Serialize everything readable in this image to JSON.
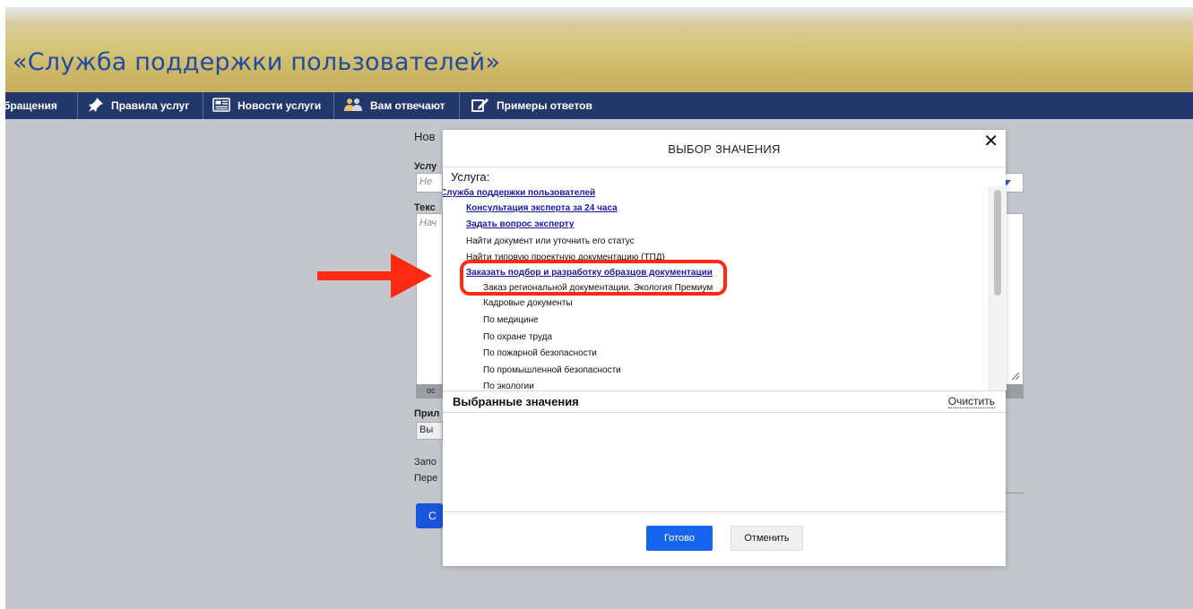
{
  "app": {
    "title": "«Служба поддержки пользователей»"
  },
  "nav": {
    "items": [
      {
        "label": "бращения",
        "icon": "none"
      },
      {
        "label": "Правила услуг",
        "icon": "pin-icon"
      },
      {
        "label": "Новости услуги",
        "icon": "news-icon"
      },
      {
        "label": "Вам отвечают",
        "icon": "people-icon"
      },
      {
        "label": "Примеры ответов",
        "icon": "edit-icon"
      }
    ]
  },
  "background_form": {
    "heading_fragment": "Нов",
    "service_label_fragment": "Услу",
    "service_placeholder_fragment": "Не",
    "text_label_fragment": "Текс",
    "text_placeholder_fragment": "Нач",
    "status_fragment": "ос",
    "attach_label_fragment": "Прил",
    "attach_button_fragment": "Вы",
    "note1_fragment": "Запо",
    "note2_fragment": "Пере",
    "submit_fragment": "С"
  },
  "modal": {
    "title": "ВЫБОР ЗНАЧЕНИЯ",
    "close_symbol": "✕",
    "section_label": "Услуга:",
    "tree": [
      {
        "label": "Служба поддержки пользователей",
        "level": 0,
        "link": true
      },
      {
        "label": "Консультация эксперта за 24 часа",
        "level": 1,
        "link": true
      },
      {
        "label": "Задать вопрос эксперту",
        "level": 1,
        "link": true
      },
      {
        "label": "Найти документ или уточнить его статус",
        "level": 1,
        "link": false
      },
      {
        "label": "Найти типовую проектную документацию (ТПД)",
        "level": 1,
        "link": false
      },
      {
        "label": "Заказать подбор и разработку образцов документации",
        "level": 1,
        "link": true
      },
      {
        "label": "Заказ региональной документации. Экология Премиум",
        "level": 2,
        "link": false
      },
      {
        "label": "Кадровые документы",
        "level": 2,
        "link": false
      },
      {
        "label": "По медицине",
        "level": 2,
        "link": false
      },
      {
        "label": "По охране труда",
        "level": 2,
        "link": false
      },
      {
        "label": "По пожарной безопасности",
        "level": 2,
        "link": false
      },
      {
        "label": "По промышленной безопасности",
        "level": 2,
        "link": false
      },
      {
        "label": "По экологии",
        "level": 2,
        "link": false
      }
    ],
    "selected_label": "Выбранные значения",
    "clear_label": "Очистить",
    "ok_label": "Готово",
    "cancel_label": "Отменить"
  },
  "colors": {
    "nav_bg": "#23386a",
    "title_color": "#1f4aa6",
    "primary_button": "#1565f0",
    "highlight": "#ff2a12",
    "link": "#1a1aa6"
  }
}
